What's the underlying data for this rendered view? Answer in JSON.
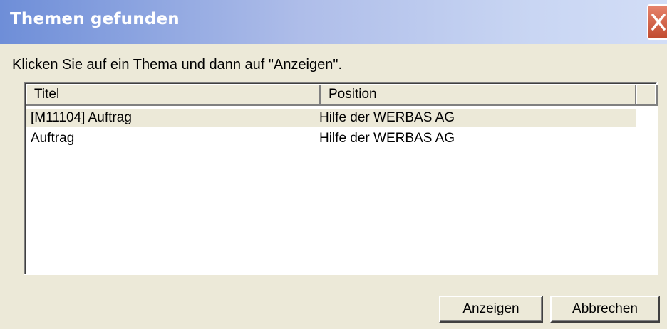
{
  "window": {
    "title": "Themen gefunden"
  },
  "instruction": "Klicken Sie auf ein Thema und dann auf \"Anzeigen\".",
  "list": {
    "columns": [
      "Titel",
      "Position",
      ""
    ],
    "rows": [
      {
        "title": "[M11104] Auftrag",
        "position": "Hilfe der WERBAS AG",
        "selected": true
      },
      {
        "title": "Auftrag",
        "position": "Hilfe der WERBAS AG",
        "selected": false
      }
    ]
  },
  "buttons": {
    "show": "Anzeigen",
    "cancel": "Abbrechen"
  },
  "icons": {
    "close": "close-icon"
  },
  "colors": {
    "dialog_bg": "#ece9d8",
    "titlebar_start": "#6e8ed8",
    "titlebar_end": "#d2ddf6",
    "close_button": "#c14b2f"
  }
}
